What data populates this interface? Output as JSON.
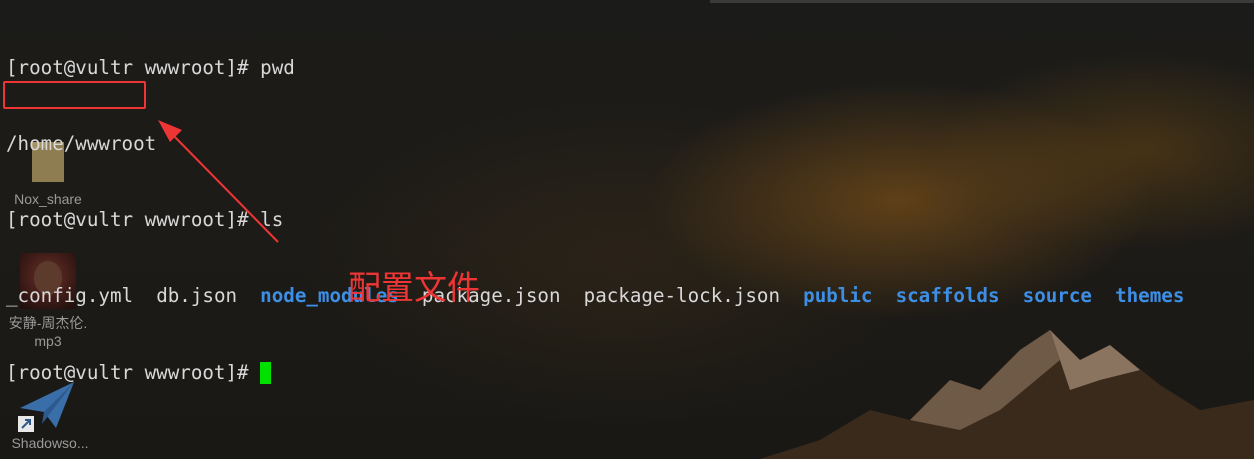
{
  "terminal": {
    "lines": [
      {
        "prompt": "[root@vultr wwwroot]# ",
        "command": "pwd"
      },
      {
        "output": "/home/wwwroot"
      },
      {
        "prompt": "[root@vultr wwwroot]# ",
        "command": "ls"
      },
      {
        "prompt": "[root@vultr wwwroot]# ",
        "command": ""
      }
    ],
    "ls_entries": [
      {
        "name": "_config.yml",
        "type": "file"
      },
      {
        "name": "db.json",
        "type": "file"
      },
      {
        "name": "node_modules",
        "type": "dir"
      },
      {
        "name": "package.json",
        "type": "file"
      },
      {
        "name": "package-lock.json",
        "type": "file"
      },
      {
        "name": "public",
        "type": "dir"
      },
      {
        "name": "scaffolds",
        "type": "dir"
      },
      {
        "name": "source",
        "type": "dir"
      },
      {
        "name": "themes",
        "type": "dir"
      }
    ]
  },
  "annotation": {
    "text": "配置文件",
    "color": "#ee3535"
  },
  "desktop_icons": [
    {
      "label": "Nox_share",
      "icon": "folder-icon"
    },
    {
      "label_lines": [
        "安静-周杰伦.",
        "mp3"
      ],
      "icon": "mp3-file-icon"
    },
    {
      "label": "Shadowso...",
      "icon": "shadowsocks-icon"
    }
  ],
  "colors": {
    "text": "#d8d8d8",
    "directory": "#3d8fe6",
    "cursor": "#00e100",
    "highlight": "#ee3535"
  }
}
